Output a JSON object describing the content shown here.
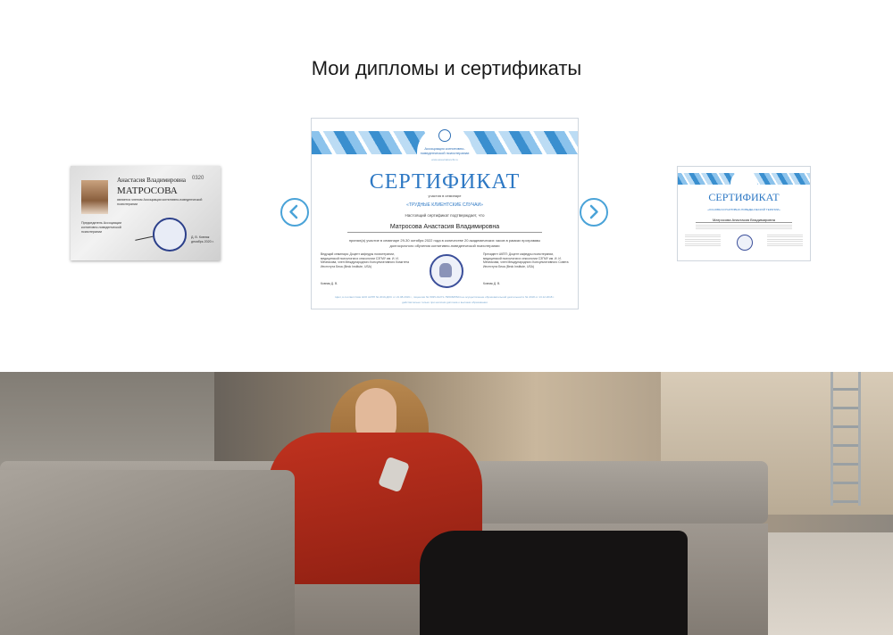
{
  "section": {
    "title": "Мои дипломы и сертификаты"
  },
  "carousel": {
    "prev_icon": "chevron-left-icon",
    "next_icon": "chevron-right-icon",
    "accent_color": "#4aa3d8"
  },
  "membership_card": {
    "name_line1": "Анастасия Владимировна",
    "name_line2": "МАТРОСОВА",
    "number": "0320",
    "description": "является членом Ассоциации когнитивно-поведенческой психотерапии",
    "left_text": "Председатель Ассоциации когнитивно-поведенческой психотерапии",
    "sign_text": "Д. В. Ковпак",
    "date_text": "декабрь 2020 г."
  },
  "certificate": {
    "org": "Ассоциация когнитивно-поведенческой психотерапии",
    "site": "www.associationcbt.ru",
    "title": "СЕРТИФИКАТ",
    "seminar_label": "участия в семинаре",
    "seminar_name": "«ТРУДНЫЕ КЛИЕНТСКИЕ СЛУЧАИ»",
    "confirm": "Настоящий сертификат подтверждает, что",
    "person": "Матросова Анастасия Владимировна",
    "accepted": "принял(а) участие в семинаре 29-30 октября 2022 года в количестве 20 академических часов в рамках программы долгосрочного обучения когнитивно-поведенческой психотерапии",
    "signer_left": "Ведущий семинара: Доцент кафедры психотерапии, медицинской психологии и сексологии СЗГМУ им. И. И. Мечникова, член Международного Консультативного Комитета Института Бека (Beck Institute, USA)",
    "signer_right": "Президент АКПП: Доцент кафедры психотерапии, медицинской психологии и сексологии СЗГМУ им. И. И. Мечникова, член Международного Консультативного Совета Института Бека (Beck Institute, USA)",
    "sign_left": "Ковпак Д. В.",
    "sign_right": "Ковпак Д. В.",
    "footer1": "Цвет, в соответствии НКО АКПП № 2019-ДОС от 21.08.2019 г., лицензия № Л035-01271-78/00605524 на осуществление образовательной деятельности № 2018 от 13.12.2018 г.",
    "footer2": "действительно только при наличии диплома о высшем образовании"
  },
  "certificate_small": {
    "title": "СЕРТИФИКАТ",
    "seminar_name": "«ОСНОВЫ КОГНИТИВНО-ПОВЕДЕНЧЕСКОЙ ТЕРАПИИ»",
    "person": "Матросова Анастасия Владимировна"
  }
}
